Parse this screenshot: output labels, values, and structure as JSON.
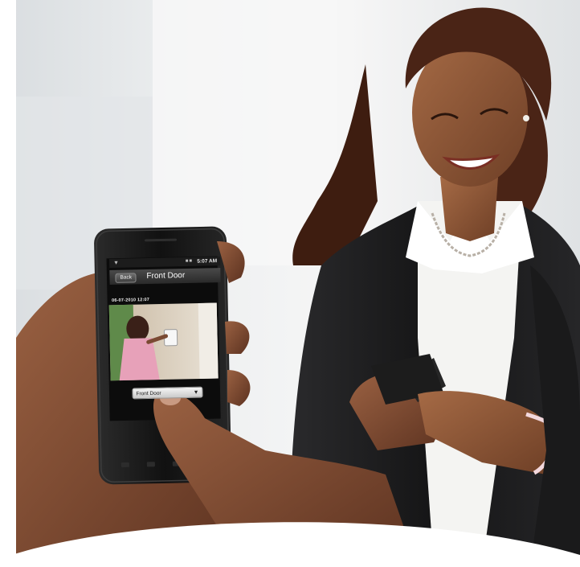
{
  "phone_app": {
    "back_label": "Back",
    "screen_title": "Front Door",
    "status_time": "5:07 AM",
    "timestamp": "06-07-2010  12:07",
    "camera_select_value": "Front Door"
  },
  "colors": {
    "jacket": "#1e1e20",
    "shirt": "#f4f4f2",
    "hair": "#4a2416",
    "skin": "#8a5436",
    "phone_body": "#161616",
    "background": "#e7eaec"
  }
}
